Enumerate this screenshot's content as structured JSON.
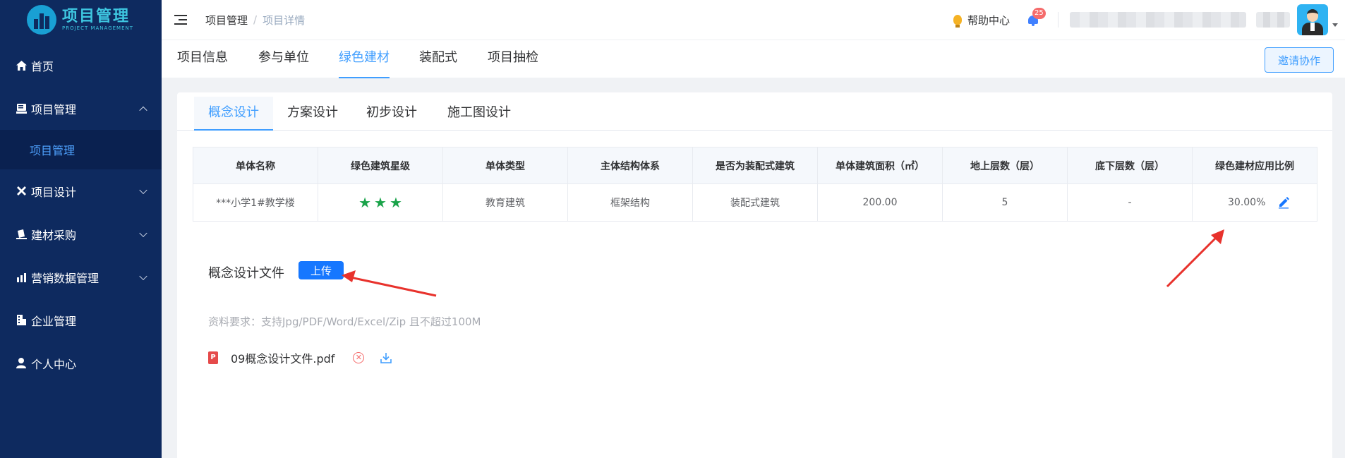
{
  "app": {
    "title": "项目管理",
    "subtitle": "PROJECT MANAGEMENT"
  },
  "sidebar": {
    "items": [
      {
        "label": "首页",
        "icon": "home-icon"
      },
      {
        "label": "项目管理",
        "icon": "book-icon",
        "expanded": true
      },
      {
        "label": "项目设计",
        "icon": "tools-icon"
      },
      {
        "label": "建材采购",
        "icon": "purchase-icon"
      },
      {
        "label": "营销数据管理",
        "icon": "chart-icon"
      },
      {
        "label": "企业管理",
        "icon": "building-icon"
      },
      {
        "label": "个人中心",
        "icon": "user-icon"
      }
    ],
    "submenu": {
      "label": "项目管理"
    }
  },
  "header": {
    "breadcrumb": [
      "项目管理",
      "项目详情"
    ],
    "help": "帮助中心",
    "notification_count": "25"
  },
  "tabs": [
    "项目信息",
    "参与单位",
    "绿色建材",
    "装配式",
    "项目抽检"
  ],
  "active_tab": "绿色建材",
  "invite_button": "邀请协作",
  "sub_tabs": [
    "概念设计",
    "方案设计",
    "初步设计",
    "施工图设计"
  ],
  "active_sub_tab": "概念设计",
  "table": {
    "headers": [
      "单体名称",
      "绿色建筑星级",
      "单体类型",
      "主体结构体系",
      "是否为装配式建筑",
      "单体建筑面积（㎡）",
      "地上层数（层）",
      "底下层数（层）",
      "绿色建材应用比例"
    ],
    "rows": [
      {
        "name": "***小学1#教学楼",
        "stars": 3,
        "type": "教育建筑",
        "structure": "框架结构",
        "prefab": "装配式建筑",
        "area": "200.00",
        "above": "5",
        "below": "-",
        "ratio": "30.00%"
      }
    ]
  },
  "files": {
    "label": "概念设计文件",
    "upload_button": "上传",
    "requirement": "资料要求：支持Jpg/PDF/Word/Excel/Zip 且不超过100M",
    "items": [
      {
        "name": "09概念设计文件.pdf",
        "type": "PDF"
      }
    ]
  },
  "colors": {
    "sidebar": "#0e2a5f",
    "accent": "#409eff",
    "star": "#1aa34a",
    "annotation_arrow": "#e8322c"
  }
}
